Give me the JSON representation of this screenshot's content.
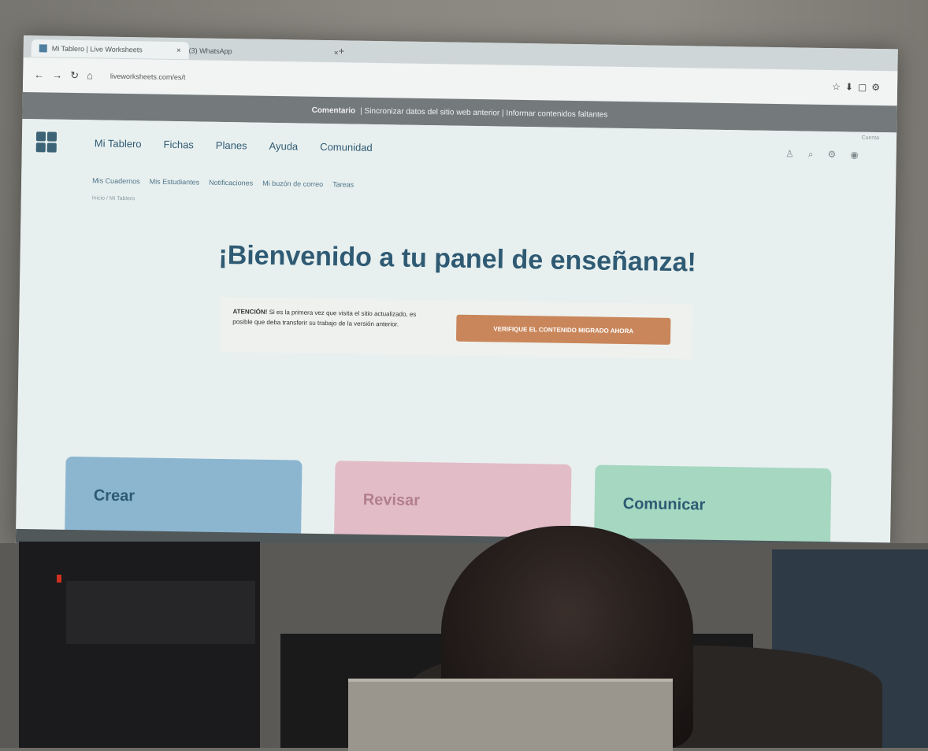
{
  "browser": {
    "tabs": [
      {
        "label": "Mi Tablero | Live Worksheets"
      },
      {
        "label": "(3) WhatsApp"
      }
    ],
    "url": "liveworksheets.com/es/t",
    "notice": {
      "bold": "Comentario",
      "text": "| Sincronizar datos del sitio web anterior | Informar contenidos faltantes"
    }
  },
  "page": {
    "account": "Cuenta",
    "main_nav": [
      "Mi Tablero",
      "Fichas",
      "Planes",
      "Ayuda",
      "Comunidad"
    ],
    "sub_nav": [
      "Mis Cuadernos",
      "Mis Estudiantes",
      "Notificaciones",
      "Mi buzón de correo",
      "Tareas"
    ],
    "breadcrumb": "Inicio / Mi Tablero",
    "title": "¡Bienvenido a tu panel de enseñanza!",
    "attention": {
      "label": "ATENCIÓN!",
      "text": "Si es la primera vez que visita el sitio actualizado, es posible que deba transferir su trabajo de la versión anterior.",
      "button": "VERIFIQUE EL CONTENIDO MIGRADO AHORA"
    },
    "cards": [
      {
        "label": "Crear",
        "icon": "pencil-icon",
        "color": "#8cb6d0"
      },
      {
        "label": "Revisar",
        "icon": "review-icon",
        "color": "#e2bcc7"
      },
      {
        "label": "Comunicar",
        "icon": "chat-icon",
        "color": "#a5d7c1"
      }
    ]
  },
  "colors": {
    "brand": "#2f5a73",
    "button": "#c9865a"
  }
}
